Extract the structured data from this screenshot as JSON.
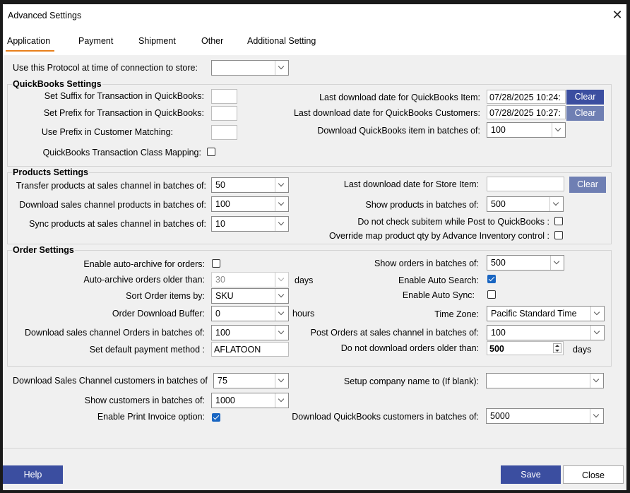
{
  "window": {
    "title": "Advanced Settings",
    "close_label": "✕"
  },
  "tabs": [
    "Application",
    "Payment",
    "Shipment",
    "Other",
    "Additional Setting"
  ],
  "protocol": {
    "label": "Use this Protocol at time of connection to store:",
    "value": ""
  },
  "qb": {
    "header": "QuickBooks Settings",
    "suffix_label": "Set Suffix for Transaction in QuickBooks:",
    "prefix_label": "Set Prefix for Transaction in QuickBooks:",
    "prefix_match_label": "Use Prefix in Customer Matching:",
    "class_mapping_label": "QuickBooks Transaction Class Mapping:",
    "last_item_label": "Last download date for QuickBooks Item:",
    "last_item_value": "07/28/2025 10:24:",
    "last_customers_label": "Last download date for QuickBooks Customers:",
    "last_customers_value": "07/28/2025 10:27:",
    "batch_label": "Download QuickBooks item in batches of:",
    "batch_value": "100",
    "clear_label": "Clear"
  },
  "products": {
    "header": "Products  Settings",
    "transfer_label": "Transfer products at sales channel in batches of:",
    "transfer_value": "50",
    "download_label": "Download sales channel products in batches of:",
    "download_value": "100",
    "sync_label": "Sync products at sales channel in batches of:",
    "sync_value": "10",
    "last_store_label": "Last download date for Store Item:",
    "last_store_value": "",
    "show_label": "Show products in batches of:",
    "show_value": "500",
    "subitem_label": "Do not check subitem while Post to QuickBooks :",
    "override_label": "Override map product qty by Advance Inventory control :",
    "clear_label": "Clear"
  },
  "orders": {
    "header": "Order Settings",
    "auto_archive_label": "Enable auto-archive for orders:",
    "archive_older_label": "Auto-archive orders older than:",
    "archive_older_value": "30",
    "days_label": "days",
    "sort_label": "Sort Order items by:",
    "sort_value": "SKU",
    "buffer_label": "Order Download Buffer:",
    "buffer_value": "0",
    "hours_label": "hours",
    "download_label": "Download sales channel Orders in batches of:",
    "download_value": "100",
    "payment_label": "Set default payment method :",
    "payment_value": "AFLATOON",
    "show_label": "Show orders in batches of:",
    "show_value": "500",
    "auto_search_label": "Enable Auto Search:",
    "auto_sync_label": "Enable Auto Sync:",
    "timezone_label": "Time Zone:",
    "timezone_value": "Pacific Standard Time",
    "post_label": "Post Orders at sales channel in batches of:",
    "post_value": "100",
    "older_label": "Do not download orders older than:",
    "older_value": "500",
    "days2_label": "days"
  },
  "customers": {
    "download_label": "Download Sales Channel customers in batches of",
    "download_value": "75",
    "show_label": "Show customers in batches of:",
    "show_value": "1000",
    "print_label": "Enable Print Invoice option:",
    "company_label": "Setup company name to (If blank):",
    "company_value": "",
    "qb_customers_label": "Download QuickBooks customers in batches of:",
    "qb_customers_value": "5000"
  },
  "footer": {
    "help": "Help",
    "save": "Save",
    "close": "Close"
  },
  "colors": {
    "accent": "#e8801c",
    "button": "#3b4ea0",
    "checkbox": "#1a66c2"
  }
}
